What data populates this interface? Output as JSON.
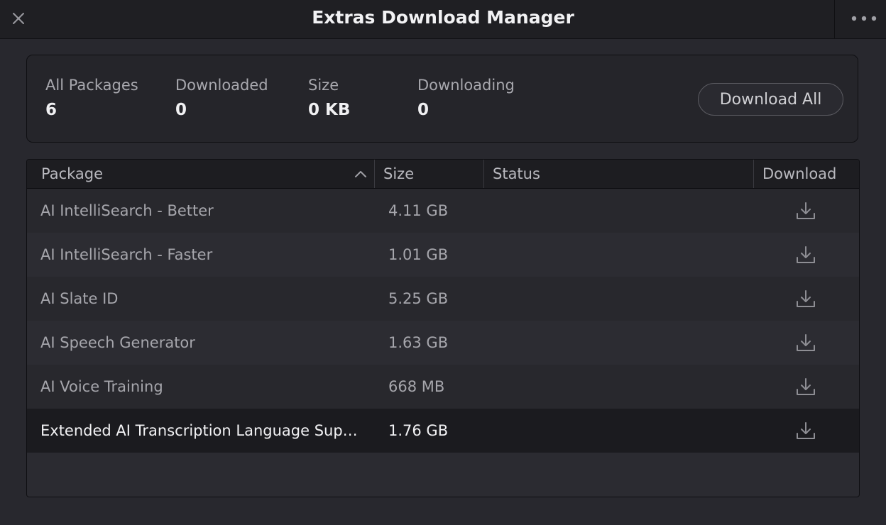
{
  "window": {
    "title": "Extras Download Manager"
  },
  "summary": {
    "all_packages_label": "All Packages",
    "all_packages_value": "6",
    "downloaded_label": "Downloaded",
    "downloaded_value": "0",
    "size_label": "Size",
    "size_value": "0 KB",
    "downloading_label": "Downloading",
    "downloading_value": "0",
    "download_all_label": "Download All"
  },
  "table": {
    "columns": [
      "Package",
      "Size",
      "Status",
      "Download"
    ],
    "sort": "ascending",
    "rows": [
      {
        "name": "AI IntelliSearch - Better",
        "size": "4.11 GB",
        "status": ""
      },
      {
        "name": "AI IntelliSearch - Faster",
        "size": "1.01 GB",
        "status": ""
      },
      {
        "name": "AI Slate ID",
        "size": "5.25 GB",
        "status": ""
      },
      {
        "name": "AI Speech Generator",
        "size": "1.63 GB",
        "status": ""
      },
      {
        "name": "AI Voice Training",
        "size": "668 MB",
        "status": ""
      },
      {
        "name": "Extended AI Transcription Language Supp...",
        "size": "1.76 GB",
        "status": "",
        "selected": true
      }
    ]
  },
  "icons": {
    "close": "close-icon",
    "more": "more-horizontal-icon",
    "sort": "chevron-up-icon",
    "download": "download-icon"
  },
  "colors": {
    "background": "#28282e",
    "titlebar": "#1f1f23",
    "selected_row": "#1b1b1f"
  }
}
